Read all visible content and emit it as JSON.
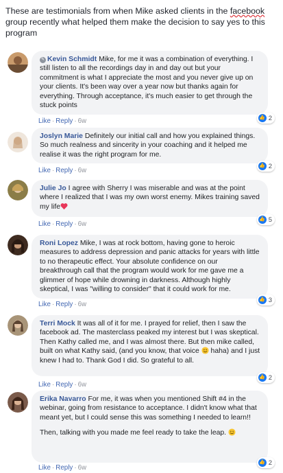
{
  "intro": {
    "text_before": "These are testimonials from when Mike asked clients in the ",
    "link_word": "facebook",
    "text_after": " group recently what helped them make the decision to say yes to this program"
  },
  "actions": {
    "like": "Like",
    "reply": "Reply",
    "separator": "·"
  },
  "comments": [
    {
      "author": "Kevin Schmidt",
      "text": "Mike, for me it was a combination of everything. I still listen to all the recordings day in and day out but your commitment is what I appreciate the most and you never give up on your clients. It's been way over a year now but thanks again for everything. Through acceptance, it's much easier to get through the stuck points",
      "time": "6w",
      "reactions": "2",
      "avatar_color": "#b07a52",
      "author_icon": "author-badge-icon"
    },
    {
      "author": "Joslyn Marie",
      "text": "Definitely our initial call and how you explained things. So much realness and sincerity in your coaching and it helped me realise it was the right program for me.",
      "time": "6w",
      "reactions": "2",
      "avatar_color": "#e9dfd4"
    },
    {
      "author": "Julie Jo",
      "text": "I agree with Sherry I was miserable and was at the point where I realized that I was my own worst enemy. Mikes training saved my life",
      "emoji": "heart-emoji",
      "time": "6w",
      "reactions": "5",
      "avatar_color": "#7a6a3a"
    },
    {
      "author": "Roni Lopez",
      "text": "Mike, I was at rock bottom, having gone to heroic measures to address depression and panic attacks for years with little to no therapeutic effect. Your absolute confidence on our breakthrough call that the program would work for me gave me a glimmer of hope while drowning in darkness. Although highly skeptical, I was \"willing to consider\" that it could work for me.",
      "time": "6w",
      "reactions": "3",
      "avatar_color": "#4b3426"
    },
    {
      "author": "Terri Mock",
      "text_before_emoji": "It was all of it for me. I prayed for relief, then I saw the facebook ad. The masterclass peaked my interest but I was skeptical. Then Kathy called me, and I was almost there. But then mike called, built on what Kathy said, (and you know, that voice ",
      "text_after_emoji": " haha) and I just knew I had to. Thank God I did. So grateful to all.",
      "emoji": "smile-emoji",
      "time": "6w",
      "reactions": "2",
      "avatar_color": "#8f7a5e"
    },
    {
      "author": "Erika Navarro",
      "text": "For me, it was when you mentioned Shift #4 in the webinar, going from resistance to acceptance. I didn't know what that meant yet, but I could sense this was something I needed to learn!!",
      "text2": "Then, talking with you made me feel ready to take the leap.",
      "emoji": "smile-emoji",
      "time": "6w",
      "reactions": "2",
      "avatar_color": "#6a4b3d"
    }
  ]
}
